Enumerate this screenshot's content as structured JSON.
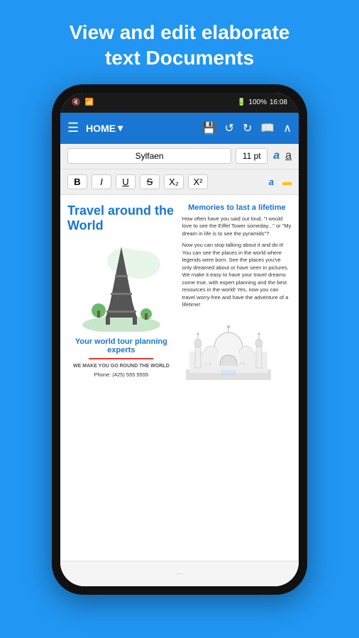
{
  "hero": {
    "line1": "View and edit elaborate",
    "line2": "text Documents"
  },
  "status_bar": {
    "time": "16:08",
    "battery": "100%",
    "signal": "📶"
  },
  "toolbar": {
    "menu_icon": "☰",
    "title": "HOME",
    "dropdown_icon": "▾",
    "save_icon": "💾",
    "undo_icon": "↺",
    "redo_icon": "↻",
    "book_icon": "📖",
    "up_icon": "∧"
  },
  "format_bar": {
    "font_name": "Sylfaen",
    "font_size": "11 pt"
  },
  "format_buttons": {
    "bold": "B",
    "italic": "I",
    "underline": "U",
    "strikethrough": "S",
    "subscript": "X₂",
    "superscript": "X²"
  },
  "document": {
    "left_title": "Travel around the World",
    "memories_title": "Memories to last a lifetime",
    "body_text_1": "How often have you said out loud, \"I would love to see the Eiffel Tower someday...\" or \"My dream in life is to see the pyramids\"?",
    "body_text_2": "Now you can stop talking about it and do it! You can see the places in the world where legends were born. See the places you've only dreamed about or have seen in pictures. We make it easy to have your travel dreams come true, with expert planning and the best resources in the world! Yes, now you can travel worry-free and have the adventure of a lifetime!",
    "world_tour_title": "Your world tour planning experts",
    "we_make_text": "WE MAKE YOU GO ROUND THE WORLD",
    "phone_text": "Phone: (425) 555 5555"
  }
}
